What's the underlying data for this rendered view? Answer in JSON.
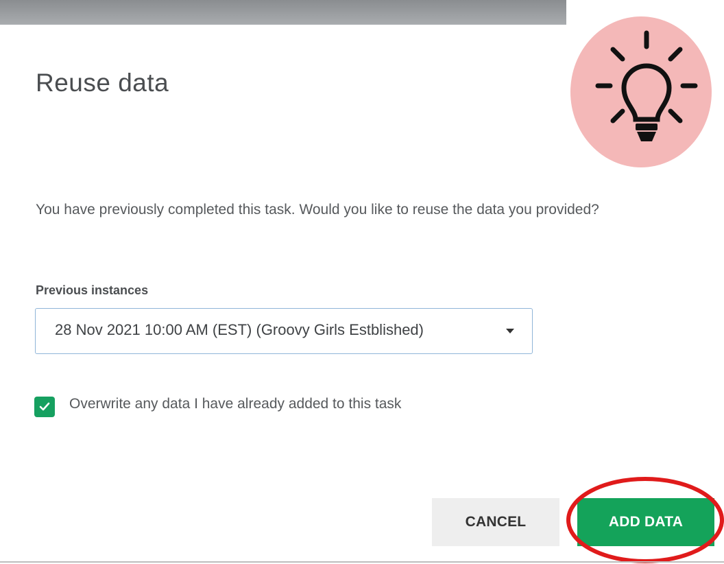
{
  "dialog": {
    "title": "Reuse data",
    "message": "You have previously completed this task. Would you like to reuse the data you provided?",
    "previous_instances_label": "Previous instances",
    "previous_instance_selected": "28 Nov 2021 10:00 AM (EST) (Groovy Girls Estblished)",
    "overwrite_checked": true,
    "overwrite_label": "Overwrite any data I have already added to this task",
    "cancel_label": "CANCEL",
    "add_data_label": "ADD DATA"
  },
  "colors": {
    "primary_green": "#14a35a",
    "select_border": "#8fb5d8",
    "annotation_red": "#e01b1b",
    "tip_badge_pink": "#f4b8b8"
  },
  "icons": {
    "tip_badge": "lightbulb-icon",
    "dropdown": "caret-down-icon",
    "checkbox": "checkmark-icon"
  }
}
